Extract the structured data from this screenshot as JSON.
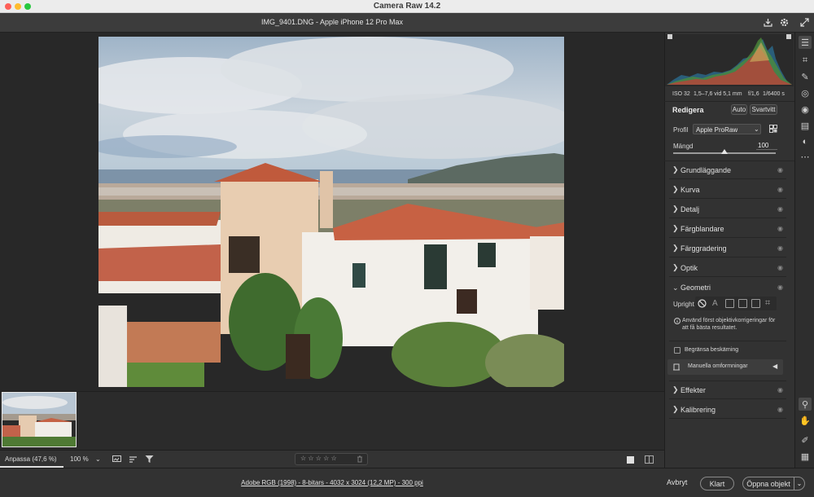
{
  "window": {
    "title": "Camera Raw 14.2",
    "file_info": "IMG_9401.DNG  -  Apple iPhone 12 Pro Max"
  },
  "camera": {
    "iso": "ISO 32",
    "lens": "1,5–7,6 vid 5,1 mm",
    "aperture": "f/1,6",
    "shutter": "1/6400 s"
  },
  "edit": {
    "heading": "Redigera",
    "auto_label": "Auto",
    "bw_label": "Svartvitt",
    "profile_label": "Profil",
    "profile_value": "Apple ProRaw",
    "amount_label": "Mängd",
    "amount_value": "100",
    "amount_fraction": 0.5
  },
  "sections": [
    "Grundläggande",
    "Kurva",
    "Detalj",
    "Färgblandare",
    "Färggradering",
    "Optik"
  ],
  "geometry": {
    "heading": "Geometri",
    "upright_label": "Upright",
    "hint": "Använd först objektivkorrigeringar för att få bästa resultatet.",
    "constrain_label": "Begränsa beskärning",
    "manual_label": "Manuella omformningar"
  },
  "sections_after": [
    "Effekter",
    "Kalibrering"
  ],
  "view": {
    "fit_label": "Anpassa (47,6 %)",
    "zoom_label": "100 %",
    "rating_stars": "☆ ☆ ☆ ☆ ☆"
  },
  "footer": {
    "info_link": "Adobe RGB (1998) - 8-bitars - 4032 x 3024 (12,2 MP) - 300 ppi",
    "cancel_label": "Avbryt",
    "done_label": "Klart",
    "open_label": "Öppna objekt"
  },
  "icons": [
    "export-icon",
    "gear-icon",
    "expand-icon",
    "edit-icon",
    "crop-icon",
    "heal-icon",
    "mask-icon",
    "redeye-icon",
    "snapshots-icon",
    "presets-icon",
    "more-icon",
    "zoom-icon",
    "hand-icon",
    "sampler-icon",
    "grid-icon"
  ],
  "colors": {
    "accent": "#2b6fd6",
    "panel": "#323232",
    "background": "#282828"
  }
}
